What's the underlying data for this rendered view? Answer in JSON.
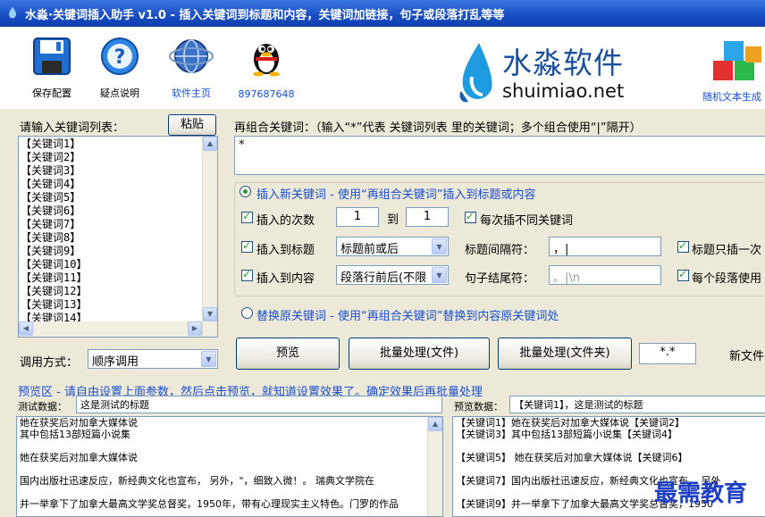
{
  "window": {
    "title": "水淼·关键词插入助手 v1.0 - 插入关键词到标题和内容，关键词加链接，句子或段落打乱等等"
  },
  "toolbar": {
    "save_label": "保存配置",
    "help_label": "疑点说明",
    "home_label": "软件主页",
    "qq_label": "897687648",
    "brand_cn": "水淼软件",
    "brand_en": "shuimiao.net",
    "random_label": "随机文本生成"
  },
  "keywords": {
    "label": "请输入关键词列表：",
    "paste_label": "粘贴",
    "items": [
      "【关键词1】",
      "【关键词2】",
      "【关键词3】",
      "【关键词4】",
      "【关键词5】",
      "【关键词6】",
      "【关键词7】",
      "【关键词8】",
      "【关键词9】",
      "【关键词10】",
      "【关键词11】",
      "【关键词12】",
      "【关键词13】",
      "【关键词14】"
    ]
  },
  "combine": {
    "label": "再组合关键词：（输入“*”代表 关键词列表 里的关键词；多个组合使用“|”隔开）",
    "value": "*"
  },
  "insert_option": {
    "label": "插入新关键词 - 使用“再组合关键词”插入到标题或内容",
    "count_label": "插入的次数",
    "count_from": "1",
    "to_label": "到",
    "count_to": "1",
    "different_label": "每次插不同关键词",
    "title_label": "插入到标题",
    "title_position": "标题前或后",
    "title_sep_label": "标题间隔符：",
    "title_sep_value": "，|",
    "title_once_label": "标题只插一次",
    "content_label": "插入到内容",
    "content_position": "段落行前后(不限",
    "sentence_end_label": "句子结尾符：",
    "sentence_end_value": "。|\\n",
    "each_para_label": "每个段落使用"
  },
  "replace_option": {
    "label": "替换原关键词 - 使用“再组合关键词”替换到内容原关键词处"
  },
  "call_mode": {
    "label": "调用方式：",
    "value": "顺序调用"
  },
  "buttons": {
    "preview": "预览",
    "batch_file": "批量处理(文件)",
    "batch_folder": "批量处理(文件夹)",
    "filter": "*.*",
    "new_file": "新文件"
  },
  "preview": {
    "header": "预览区 - 请自由设置上面参数，然后点击预览，就知道设置效果了。确定效果后再批量处理",
    "test_label": "测试数据：",
    "test_value": "这是测试的标题",
    "result_label": "预览数据：",
    "result_value": "【关键词1】，这是测试的标题",
    "test_lines": [
      "她在获奖后对加拿大媒体说",
      "其中包括13部短篇小说集",
      "",
      "  她在获奖后对加拿大媒体说",
      "",
      "国内出版社迅速反应，新经典文化也宣布，  另外，\"，细致入微！。  瑞典文学院在",
      "",
      "并一举拿下了加拿大最高文学奖总督奖，1950年，带有心理现实主义特色。门罗的作品"
    ],
    "result_lines": [
      "【关键词1】她在获奖后对加拿大媒体说【关键词2】",
      "【关键词3】其中包括13部短篇小说集【关键词4】",
      "",
      "【关键词5】  她在获奖后对加拿大媒体说【关键词6】",
      "",
      "【关键词7】国内出版社迅速反应，新经典文化也宣布，  另外",
      "",
      "【关键词9】并一举拿下了加拿大最高文学奖总督奖，1950"
    ]
  },
  "watermark": "最需教育",
  "colors": {
    "title_bar": "#1a4fc5",
    "link_blue": "#1a4fd0",
    "check_green": "#21a121"
  }
}
